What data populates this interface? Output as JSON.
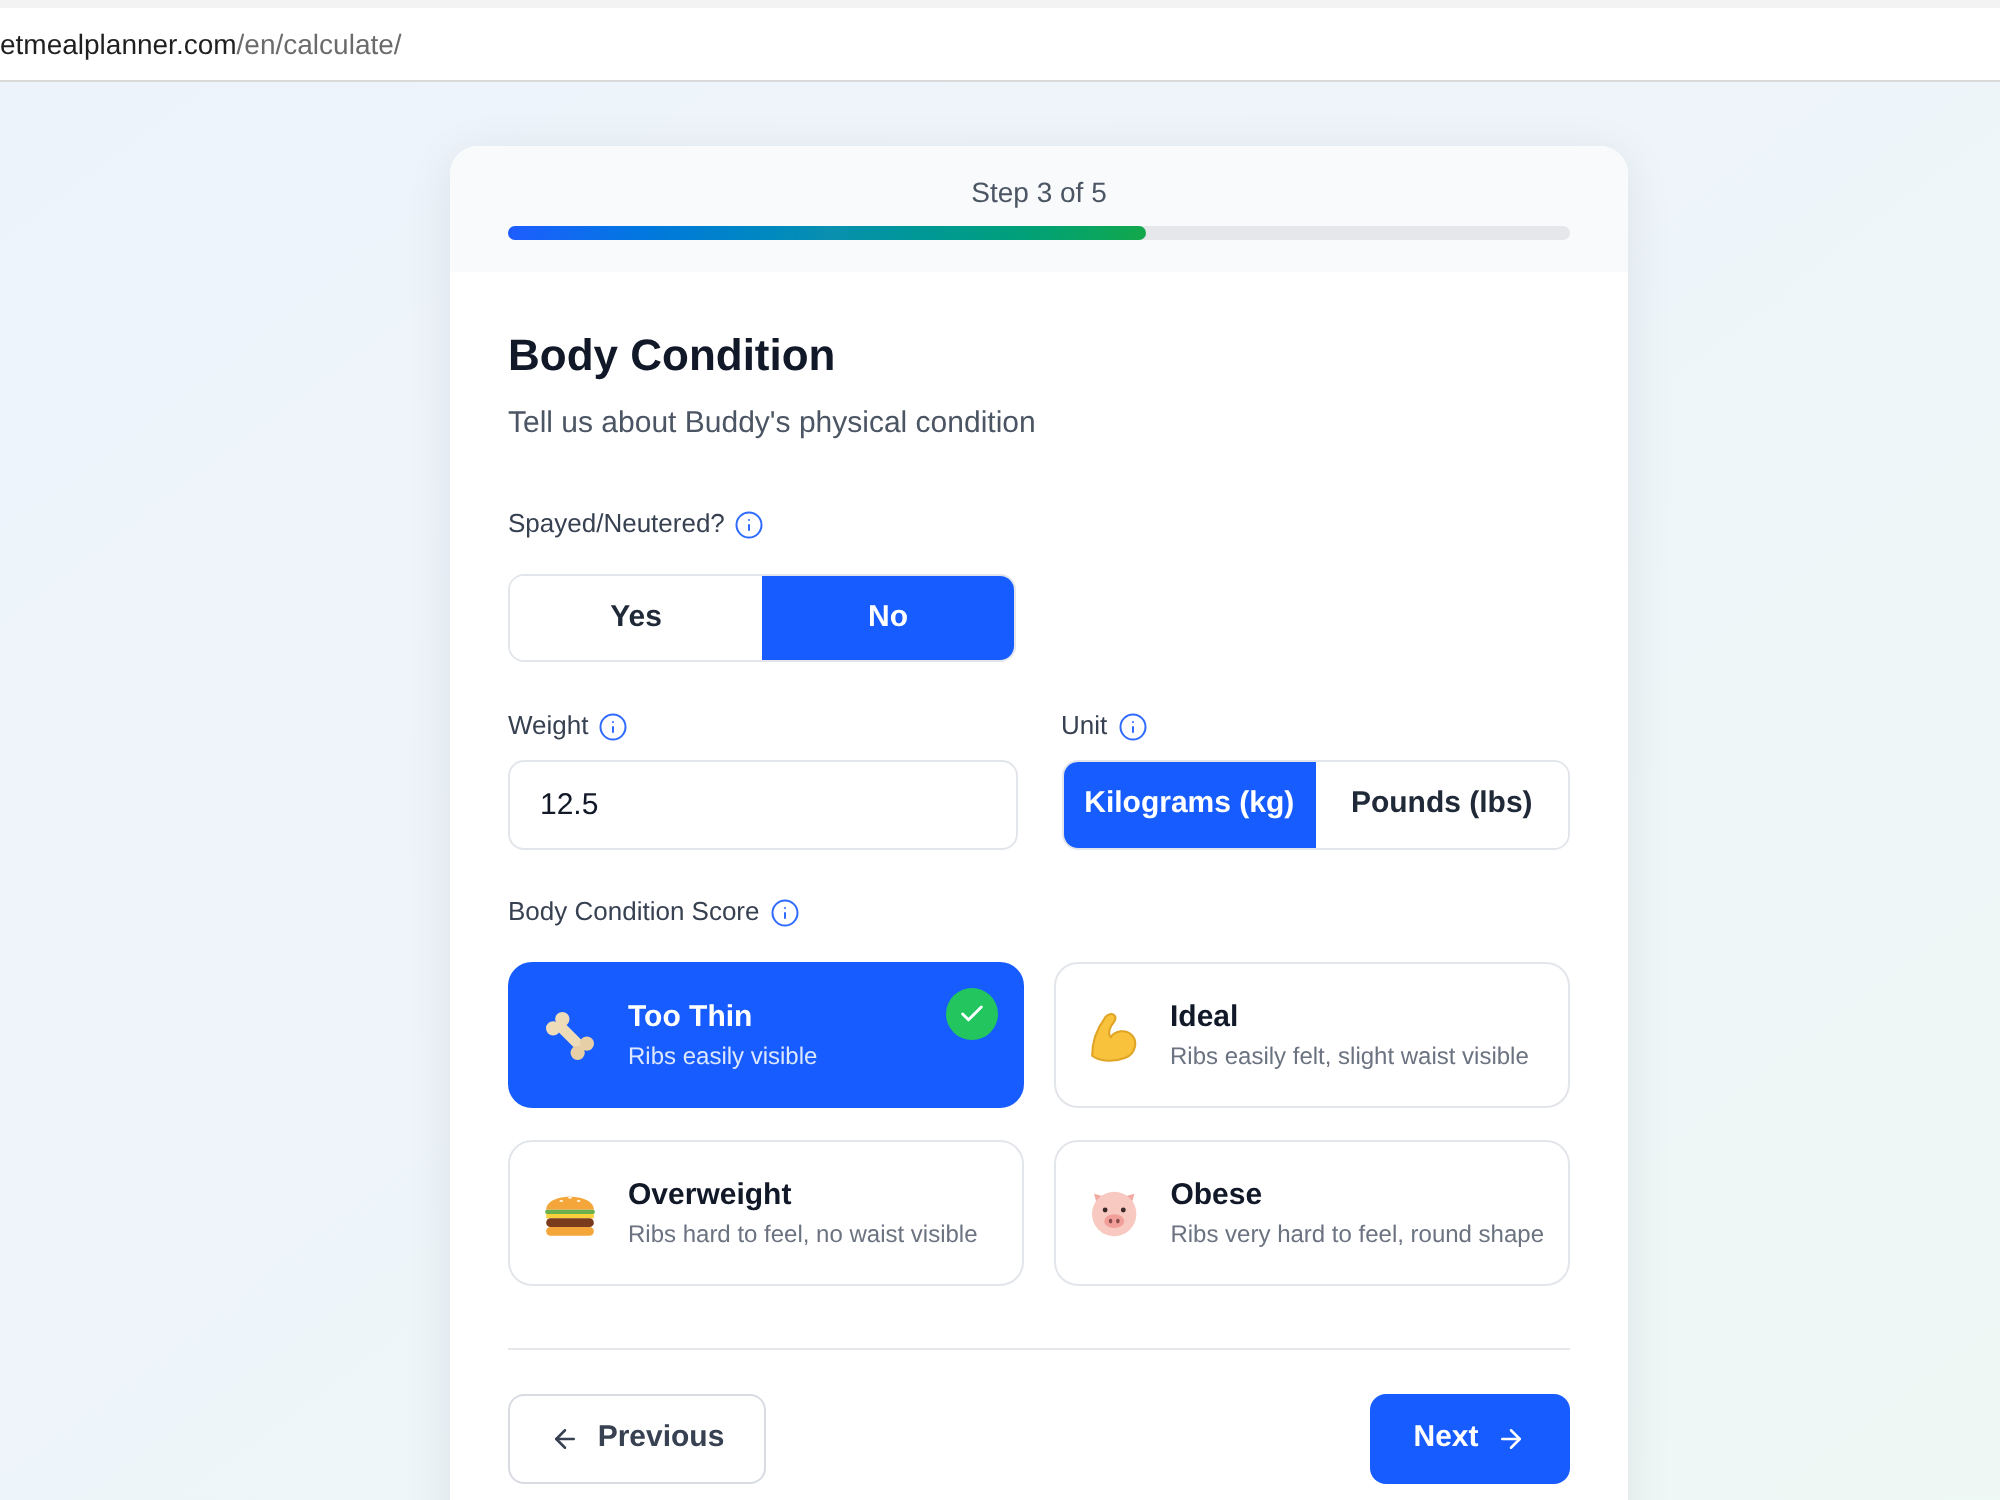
{
  "browser": {
    "url_host": "etmealplanner.com",
    "url_path": "/en/calculate/"
  },
  "progress": {
    "label": "Step 3 of 5",
    "level": 0.6
  },
  "heading": {
    "title": "Body Condition",
    "subtitle": "Tell us about Buddy's physical condition"
  },
  "spayed": {
    "label": "Spayed/Neutered?",
    "options": [
      {
        "label": "Yes",
        "selected": false
      },
      {
        "label": "No",
        "selected": true
      }
    ]
  },
  "weight": {
    "label": "Weight",
    "value": "12.5"
  },
  "unit": {
    "label": "Unit",
    "options": [
      {
        "label": "Kilograms (kg)",
        "selected": true
      },
      {
        "label": "Pounds (lbs)",
        "selected": false
      }
    ]
  },
  "body_condition_score": {
    "label": "Body Condition Score",
    "options": [
      {
        "title": "Too Thin",
        "description": "Ribs easily visible",
        "selected": true
      },
      {
        "title": "Ideal",
        "description": "Ribs easily felt, slight waist visible",
        "selected": false
      },
      {
        "title": "Overweight",
        "description": "Ribs hard to feel, no waist visible",
        "selected": false
      },
      {
        "title": "Obese",
        "description": "Ribs very hard to feel, round shape",
        "selected": false
      }
    ]
  },
  "nav": {
    "previous": "Previous",
    "next": "Next"
  }
}
